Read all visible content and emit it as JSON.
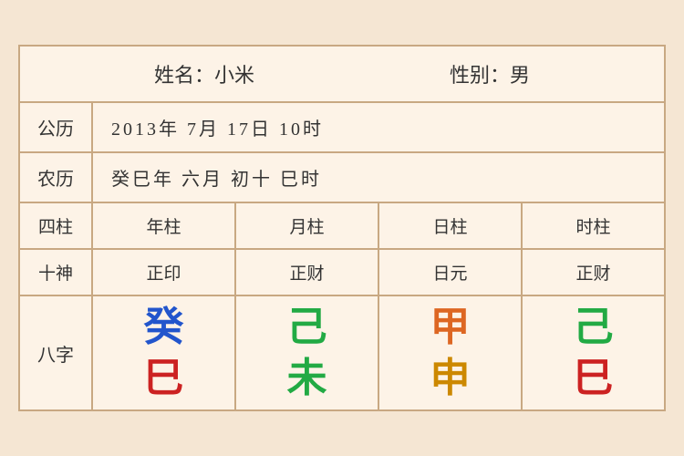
{
  "header": {
    "name_label": "姓名：小米",
    "gender_label": "性别：男"
  },
  "calendar": {
    "solar_label": "公历",
    "solar_value": "2013年 7月 17日 10时",
    "lunar_label": "农历",
    "lunar_value": "癸巳年 六月 初十 巳时"
  },
  "table": {
    "col_headers": [
      "四柱",
      "年柱",
      "月柱",
      "日柱",
      "时柱"
    ],
    "shishen_headers": [
      "十神",
      "正印",
      "正财",
      "日元",
      "正财"
    ],
    "bazi_label": "八字",
    "bazi_top": [
      "癸",
      "己",
      "甲",
      "己"
    ],
    "bazi_bottom": [
      "巳",
      "未",
      "申",
      "巳"
    ],
    "bazi_top_colors": [
      "blue",
      "green",
      "orange",
      "green"
    ],
    "bazi_bottom_colors": [
      "red",
      "green",
      "gold",
      "red"
    ]
  }
}
